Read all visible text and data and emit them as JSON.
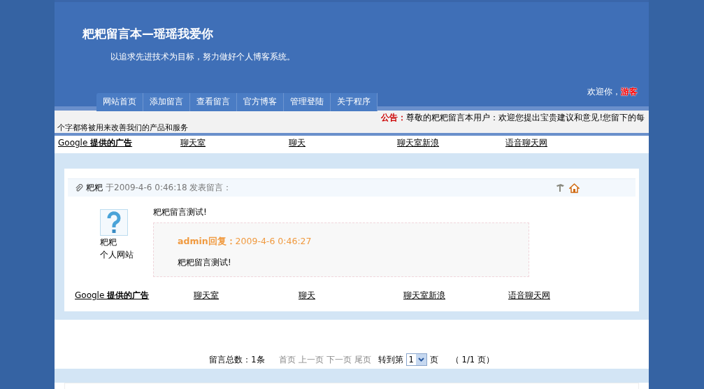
{
  "header": {
    "title": "粑粑留言本—瑶瑶我爱你",
    "subtitle": "以追求先进技术为目标，努力做好个人博客系统。",
    "welcome": "欢迎你，",
    "user": "游客"
  },
  "nav": [
    {
      "label": "网站首页"
    },
    {
      "label": "添加留言"
    },
    {
      "label": "查看留言"
    },
    {
      "label": "官方博客"
    },
    {
      "label": "管理登陆"
    },
    {
      "label": "关于程序"
    }
  ],
  "notice": {
    "label": "公告：",
    "text": "尊敬的粑粑留言本用户：欢迎您提出宝贵建议和意见!您留下的每",
    "text_2": "个字都将被用来改善我们的产品和服务"
  },
  "ads_top": [
    {
      "label": "Google **提供的广告**"
    },
    {
      "label": "聊天室"
    },
    {
      "label": "聊天"
    },
    {
      "label": "聊天室新浪"
    },
    {
      "label": "语音聊天网"
    }
  ],
  "message": {
    "author": "粑粑",
    "meta": "于2009-4-6 0:46:18 发表留言：",
    "name": "粑粑",
    "homepage": "个人网站",
    "content": "粑粑留言测试!",
    "reply_label": "admin回复：",
    "reply_time": "2009-4-6 0:46:27",
    "reply_content": "粑粑留言测试!"
  },
  "ads_bottom": [
    {
      "label": "Google **提供的广告**"
    },
    {
      "label": "聊天室"
    },
    {
      "label": "聊天"
    },
    {
      "label": "聊天室新浪"
    },
    {
      "label": "语音聊天网"
    }
  ],
  "pagination": {
    "total": "留言总数：1条",
    "first": "首页",
    "prev": "上一页",
    "next": "下一页",
    "last": "尾页",
    "goto": "转到第",
    "page_select": "1",
    "page_unit": "页",
    "summary": "（ 1/1 页）"
  }
}
